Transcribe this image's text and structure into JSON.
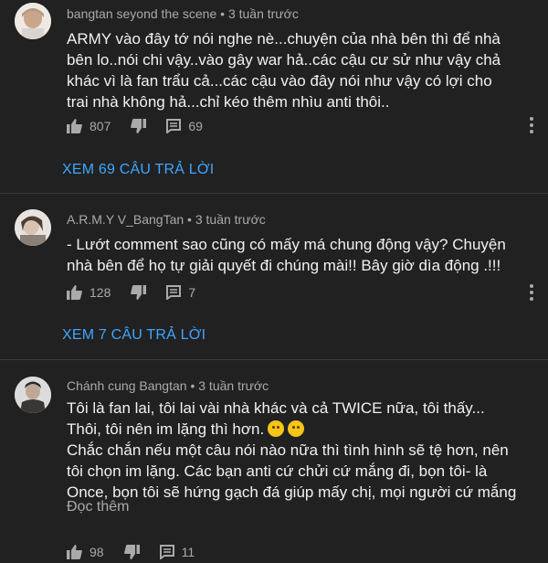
{
  "comments": [
    {
      "author": "bangtan seyond the scene",
      "time": "3 tuần trước",
      "lines": [
        "ARMY vào đây tớ nói nghe nè...chuyện của nhà bên thì để nhà",
        "bên lo..nói chi vậy..vào gây war hả..các cậu cư sử như vậy chả",
        "khác vì là fan trẩu cả...các cậu vào đây nói như vậy có lợi cho",
        "trai nhà không hả...chỉ kéo thêm nhìu anti thôi.."
      ],
      "likes": "807",
      "replies_count": "69",
      "view_replies": "XEM 69 CÂU TRẢ LỜI"
    },
    {
      "author": "A.R.M.Y V_BangTan",
      "time": "3 tuần trước",
      "lines": [
        "- Lướt comment sao cũng có mấy má chung động vậy? Chuyện",
        "nhà bên để họ tự giải quyết đi chúng mài!! Bây giờ dìa động  .!!!"
      ],
      "likes": "128",
      "replies_count": "7",
      "view_replies": "XEM 7 CÂU TRẢ LỜI"
    },
    {
      "author": "Chánh cung Bangtan",
      "time": "3 tuần trước",
      "lines": [
        "Tôi là fan lai, tôi lai vài nhà khác và cả TWICE nữa, tôi thấy...",
        "Thôi, tôi nên im lặng thì hơn.",
        "Chắc chắn nếu một câu nói nào nữa thì tình hình sẽ tệ hơn, nên",
        "tôi chọn im lặng. Các bạn anti cứ chửi cứ mắng đi, bọn tôi- là",
        "Once, bọn tôi sẽ hứng gạch đá giúp mấy chị, mọi người cứ mắng"
      ],
      "read_more": "Đọc thêm",
      "likes": "98",
      "replies_count": "11"
    }
  ],
  "separator": " • ",
  "icons": {
    "like": "thumbs-up-icon",
    "dislike": "thumbs-down-icon",
    "reply": "reply-icon",
    "more": "more-vertical-icon",
    "emoji": "grinning-face-emoji"
  },
  "colors": {
    "background": "#212121",
    "link": "#3ea6ff",
    "secondary_text": "#aaaaaa"
  }
}
